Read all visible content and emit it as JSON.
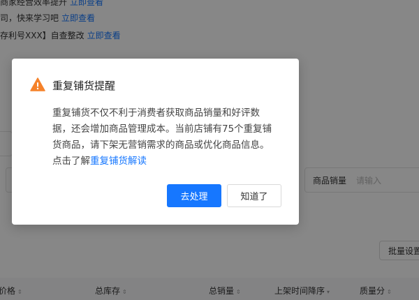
{
  "notices": [
    {
      "text": "商家经营效率提升",
      "link": "立即查看"
    },
    {
      "text": "司，快来学习吧",
      "link": "立即查看"
    },
    {
      "text": "存利号XXX】自查整改",
      "link": "立即查看"
    }
  ],
  "filters": {
    "sales_label": "商品销量",
    "sales_placeholder": "请输入"
  },
  "toolbar": {
    "batch_label": "批量设置"
  },
  "table": {
    "columns": [
      {
        "label": "价格",
        "sort": "⇕"
      },
      {
        "label": "总库存",
        "sort": "⇕"
      },
      {
        "label": "总销量",
        "sort": "⇕"
      },
      {
        "label": "上架时间降序",
        "sort": "▾"
      },
      {
        "label": "质量分",
        "sort": "⇕"
      }
    ]
  },
  "modal": {
    "title": "重复铺货提醒",
    "body_text": "重复铺货不仅不利于消费者获取商品销量和好评数据，还会增加商品管理成本。当前店铺有75个重复铺货商品，请下架无营销需求的商品或优化商品信息。点击了解",
    "body_link": "重复铺货解读",
    "primary_button": "去处理",
    "secondary_button": "知道了",
    "icon": "warning-icon",
    "accent_color": "#1677ff",
    "warning_color": "#f5822a"
  }
}
